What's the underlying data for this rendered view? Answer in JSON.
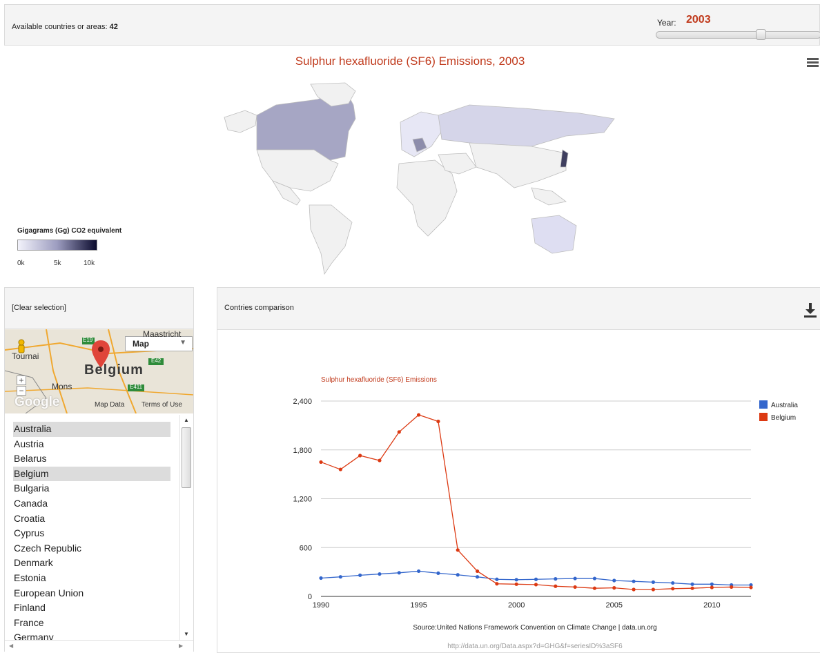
{
  "header": {
    "available_label": "Available countries or areas:",
    "available_count": "42",
    "year_label": "Year:",
    "year_value": "2003",
    "year_slider": {
      "min": 1990,
      "max": 2012,
      "value": 2003
    }
  },
  "map": {
    "title": "Sulphur hexafluoride (SF6) Emissions, 2003",
    "menu_icon": "hamburger-menu-icon",
    "legend": {
      "title": "Gigagrams (Gg) CO2 equivalent",
      "ticks": [
        "0k",
        "5k",
        "10k"
      ],
      "colors": [
        "#f2f2fb",
        "#9c9cbf",
        "#0b0b2e"
      ]
    }
  },
  "left_panel": {
    "clear_label": "[Clear selection]",
    "minimap": {
      "type_select": "Map",
      "main_label": "Belgium",
      "labels": [
        "Maastricht",
        "Tournai",
        "Mons",
        "E19",
        "E42",
        "E411"
      ],
      "footer_data": "Map Data",
      "footer_terms": "Terms of Use",
      "logo": "Google"
    },
    "countries": [
      {
        "name": "Australia",
        "selected": true
      },
      {
        "name": "Austria",
        "selected": false
      },
      {
        "name": "Belarus",
        "selected": false
      },
      {
        "name": "Belgium",
        "selected": true
      },
      {
        "name": "Bulgaria",
        "selected": false
      },
      {
        "name": "Canada",
        "selected": false
      },
      {
        "name": "Croatia",
        "selected": false
      },
      {
        "name": "Cyprus",
        "selected": false
      },
      {
        "name": "Czech Republic",
        "selected": false
      },
      {
        "name": "Denmark",
        "selected": false
      },
      {
        "name": "Estonia",
        "selected": false
      },
      {
        "name": "European Union",
        "selected": false
      },
      {
        "name": "Finland",
        "selected": false
      },
      {
        "name": "France",
        "selected": false
      },
      {
        "name": "Germany",
        "selected": false
      }
    ]
  },
  "comparison": {
    "header_label": "Contries comparison",
    "download_icon": "download-icon",
    "source_text": "Source:United Nations Framework Convention on Climate Change | data.un.org",
    "url_text": "http://data.un.org/Data.aspx?d=GHG&f=seriesID%3aSF6"
  },
  "chart_data": {
    "type": "line",
    "title": "Sulphur hexafluoride (SF6) Emissions",
    "xlabel": "",
    "ylabel": "",
    "x": [
      1990,
      1991,
      1992,
      1993,
      1994,
      1995,
      1996,
      1997,
      1998,
      1999,
      2000,
      2001,
      2002,
      2003,
      2004,
      2005,
      2006,
      2007,
      2008,
      2009,
      2010,
      2011,
      2012
    ],
    "xticks": [
      "1990",
      "1995",
      "2000",
      "2005",
      "2010"
    ],
    "yticks": [
      "0",
      "600",
      "1,200",
      "1,800",
      "2,400"
    ],
    "ylim": [
      0,
      2400
    ],
    "grid": true,
    "legend_position": "right",
    "series": [
      {
        "name": "Australia",
        "color": "#3366cc",
        "values": [
          225,
          240,
          260,
          275,
          290,
          310,
          285,
          265,
          240,
          210,
          205,
          210,
          215,
          220,
          220,
          195,
          185,
          175,
          165,
          150,
          150,
          140,
          140
        ]
      },
      {
        "name": "Belgium",
        "color": "#dc3912",
        "values": [
          1650,
          1560,
          1730,
          1670,
          2020,
          2230,
          2150,
          570,
          310,
          155,
          150,
          145,
          125,
          115,
          100,
          105,
          85,
          85,
          95,
          100,
          110,
          115,
          110
        ]
      }
    ]
  }
}
